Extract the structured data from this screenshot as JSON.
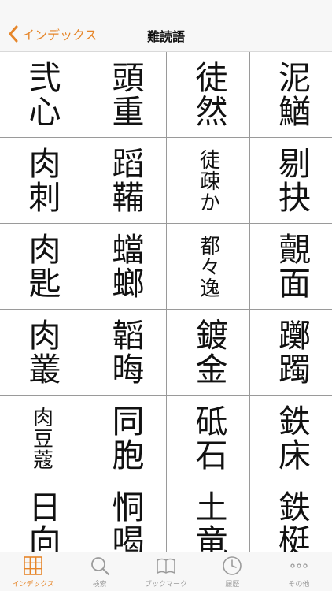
{
  "nav": {
    "back_label": "インデックス",
    "title": "難読語"
  },
  "words": [
    {
      "text": "弐心",
      "small": false
    },
    {
      "text": "頭重",
      "small": false
    },
    {
      "text": "徒然",
      "small": false
    },
    {
      "text": "泥鰌",
      "small": false
    },
    {
      "text": "肉刺",
      "small": false
    },
    {
      "text": "蹈鞴",
      "small": false
    },
    {
      "text": "徒疎か",
      "small": true
    },
    {
      "text": "剔抉",
      "small": false
    },
    {
      "text": "肉匙",
      "small": false
    },
    {
      "text": "蟷螂",
      "small": false
    },
    {
      "text": "都々逸",
      "small": true
    },
    {
      "text": "覿面",
      "small": false
    },
    {
      "text": "肉叢",
      "small": false
    },
    {
      "text": "韜晦",
      "small": false
    },
    {
      "text": "鍍金",
      "small": false
    },
    {
      "text": "躑躅",
      "small": false
    },
    {
      "text": "肉豆蔻",
      "small": true
    },
    {
      "text": "同胞",
      "small": false
    },
    {
      "text": "砥石",
      "small": false
    },
    {
      "text": "鉄床",
      "small": false
    },
    {
      "text": "日向",
      "small": false
    },
    {
      "text": "恫喝",
      "small": false
    },
    {
      "text": "土竜",
      "small": false
    },
    {
      "text": "鉄梃",
      "small": false
    }
  ],
  "tabs": [
    {
      "label": "インデックス",
      "icon": "grid-icon",
      "active": true
    },
    {
      "label": "検索",
      "icon": "search-icon",
      "active": false
    },
    {
      "label": "ブックマーク",
      "icon": "book-icon",
      "active": false
    },
    {
      "label": "履歴",
      "icon": "clock-icon",
      "active": false
    },
    {
      "label": "その他",
      "icon": "more-icon",
      "active": false
    }
  ],
  "colors": {
    "accent": "#e6862a",
    "inactive": "#9b9b9b",
    "grid_line": "#9a9a9a"
  }
}
